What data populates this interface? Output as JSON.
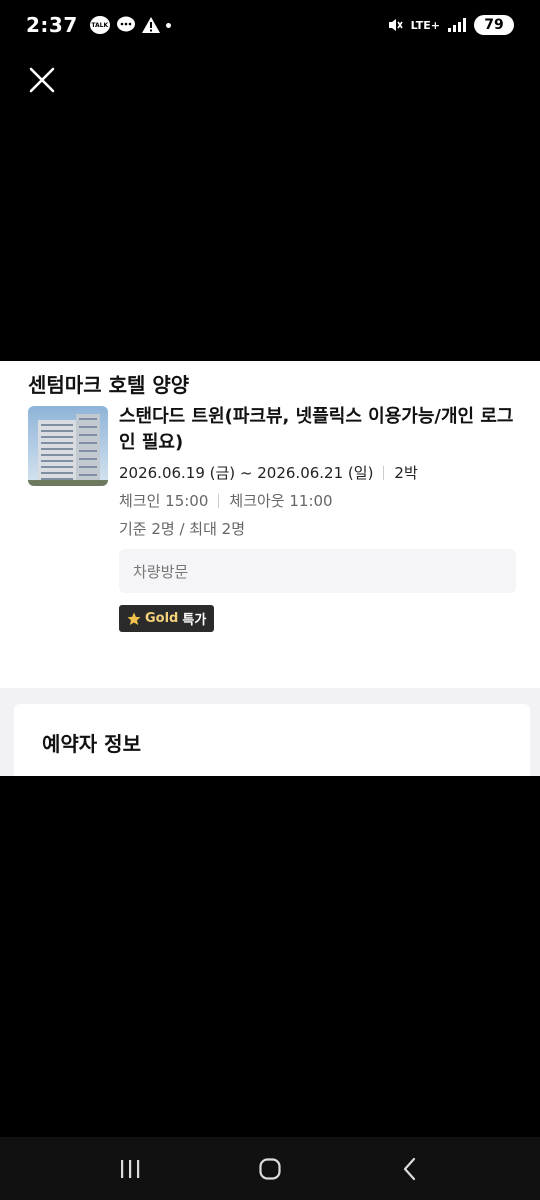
{
  "status_bar": {
    "time": "2:37",
    "talk_label": "TALK",
    "network": "LTE+",
    "battery": "79"
  },
  "hotel": {
    "name": "센텀마크 호텔 양양",
    "room_name": "스탠다드 트윈(파크뷰, 넷플릭스 이용가능/개인 로그인 필요)",
    "dates": "2026.06.19 (금) ~ 2026.06.21 (일)",
    "nights": "2박",
    "checkin": "체크인 15:00",
    "checkout": "체크아웃 11:00",
    "capacity": "기준 2명 / 최대 2명",
    "visit_method": "차량방문",
    "badge_gold": "Gold",
    "badge_deal": "특가"
  },
  "booker_section": {
    "title": "예약자 정보"
  },
  "icons": {
    "close": "close-icon",
    "recent": "recent-apps-icon",
    "home": "home-icon",
    "back": "back-icon"
  }
}
